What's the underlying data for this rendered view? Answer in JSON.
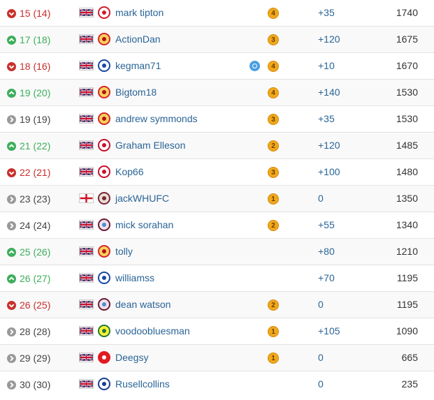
{
  "colors": {
    "up": "#3dae5c",
    "down": "#c9302c",
    "same": "#999999",
    "link": "#2a6496",
    "medal": "#f0a81c",
    "chip": "#4a9fe0"
  },
  "rows": [
    {
      "movement": "down",
      "position": "15 (14)",
      "flag": "uk-flag-icon",
      "crest": "nottingham-forest-crest-icon",
      "name": "mark tipton",
      "chip": "",
      "medal": "4",
      "points": "+35",
      "total": "1740"
    },
    {
      "movement": "up",
      "position": "17 (18)",
      "flag": "uk-flag-icon",
      "crest": "man-utd-crest-icon",
      "name": "ActionDan",
      "chip": "",
      "medal": "3",
      "points": "+120",
      "total": "1675"
    },
    {
      "movement": "down",
      "position": "18 (16)",
      "flag": "uk-flag-icon",
      "crest": "chelsea-crest-icon",
      "name": "kegman71",
      "chip": "chip-icon",
      "medal": "4",
      "points": "+10",
      "total": "1670"
    },
    {
      "movement": "up",
      "position": "19 (20)",
      "flag": "uk-flag-icon",
      "crest": "man-utd-crest-icon",
      "name": "Bigtom18",
      "chip": "",
      "medal": "4",
      "points": "+140",
      "total": "1530"
    },
    {
      "movement": "same",
      "position": "19 (19)",
      "flag": "uk-flag-icon",
      "crest": "man-utd-crest-icon",
      "name": "andrew symmonds",
      "chip": "",
      "medal": "3",
      "points": "+35",
      "total": "1530"
    },
    {
      "movement": "up",
      "position": "21 (22)",
      "flag": "uk-flag-icon",
      "crest": "liverpool-crest-icon",
      "name": "Graham Elleson",
      "chip": "",
      "medal": "2",
      "points": "+120",
      "total": "1485"
    },
    {
      "movement": "down",
      "position": "22 (21)",
      "flag": "uk-flag-icon",
      "crest": "liverpool-crest-icon",
      "name": "Kop66",
      "chip": "",
      "medal": "3",
      "points": "+100",
      "total": "1480"
    },
    {
      "movement": "same",
      "position": "23 (23)",
      "flag": "england-flag-icon",
      "crest": "west-ham-crest-icon",
      "name": "jackWHUFC",
      "chip": "",
      "medal": "1",
      "points": "0",
      "total": "1350"
    },
    {
      "movement": "same",
      "position": "24 (24)",
      "flag": "uk-flag-icon",
      "crest": "aston-villa-crest-icon",
      "name": "mick sorahan",
      "chip": "",
      "medal": "2",
      "points": "+55",
      "total": "1340"
    },
    {
      "movement": "up",
      "position": "25 (26)",
      "flag": "uk-flag-icon",
      "crest": "man-utd-crest-icon",
      "name": "tolly",
      "chip": "",
      "medal": "",
      "points": "+80",
      "total": "1210"
    },
    {
      "movement": "up",
      "position": "26 (27)",
      "flag": "uk-flag-icon",
      "crest": "chelsea-crest-icon",
      "name": "williamss",
      "chip": "",
      "medal": "",
      "points": "+70",
      "total": "1195"
    },
    {
      "movement": "down",
      "position": "26 (25)",
      "flag": "uk-flag-icon",
      "crest": "aston-villa-crest-icon",
      "name": "dean watson",
      "chip": "",
      "medal": "2",
      "points": "0",
      "total": "1195"
    },
    {
      "movement": "same",
      "position": "28 (28)",
      "flag": "uk-flag-icon",
      "crest": "norwich-crest-icon",
      "name": "voodoobluesman",
      "chip": "",
      "medal": "1",
      "points": "+105",
      "total": "1090"
    },
    {
      "movement": "same",
      "position": "29 (29)",
      "flag": "uk-flag-icon",
      "crest": "aberdeen-crest-icon",
      "name": "Deegsy",
      "chip": "",
      "medal": "1",
      "points": "0",
      "total": "665"
    },
    {
      "movement": "same",
      "position": "30 (30)",
      "flag": "uk-flag-icon",
      "crest": "everton-crest-icon",
      "name": "Rusellcollins",
      "chip": "",
      "medal": "",
      "points": "0",
      "total": "235"
    }
  ]
}
